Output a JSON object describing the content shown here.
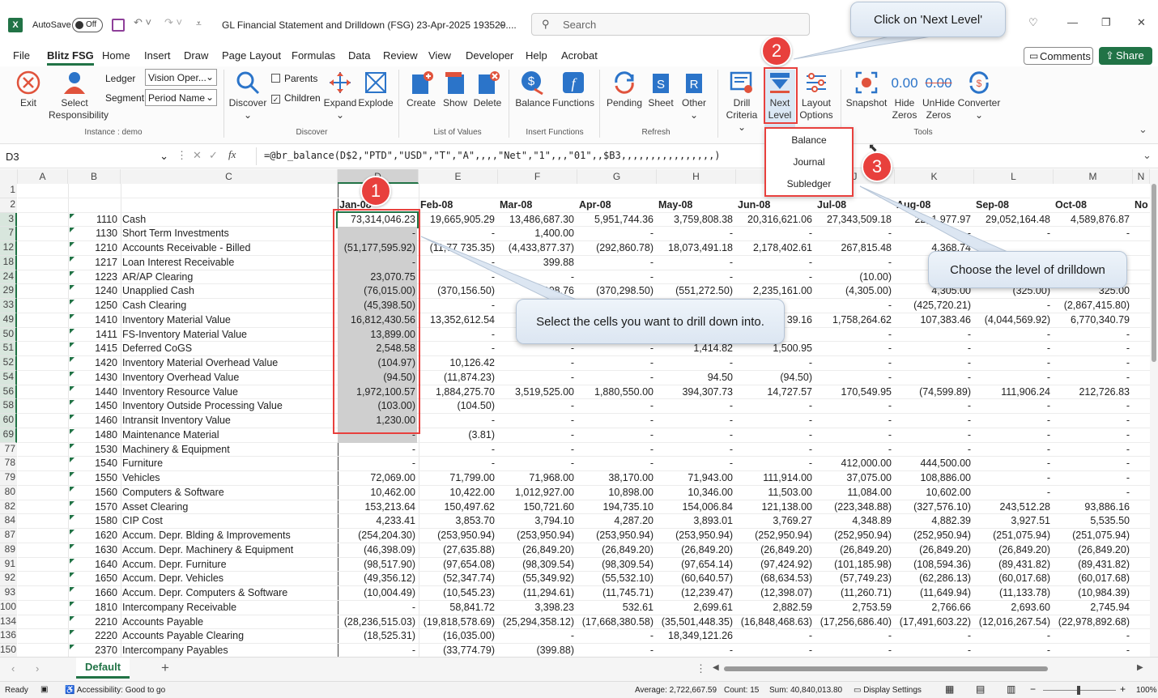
{
  "title": {
    "autosave": "AutoSave",
    "toggle": "Off",
    "doc": "GL Financial Statement and Drilldown (FSG) 23-Apr-2025 193529....",
    "search": "Search"
  },
  "menu": [
    "File",
    "Blitz FSG",
    "Home",
    "Insert",
    "Draw",
    "Page Layout",
    "Formulas",
    "Data",
    "Review",
    "View",
    "Developer",
    "Help",
    "Acrobat"
  ],
  "menu_right": {
    "comments": "Comments",
    "share": "Share"
  },
  "ribbon": {
    "exit": "Exit",
    "select_resp": "Select\nResponsibility",
    "ledger_label": "Ledger",
    "ledger_value": "Vision Oper...",
    "segment_label": "Segment",
    "segment_value": "Period Name",
    "instance": "Instance : demo",
    "discover": "Discover",
    "parents": "Parents",
    "children": "Children",
    "expand": "Expand",
    "explode": "Explode",
    "group_discover": "Discover",
    "create": "Create",
    "show": "Show",
    "delete": "Delete",
    "group_lov": "List of Values",
    "balance": "Balance",
    "functions": "Functions",
    "group_insert": "Insert Functions",
    "pending": "Pending",
    "sheet": "Sheet",
    "other": "Other",
    "group_refresh": "Refresh",
    "drill": "Drill",
    "criteria": "Criteria",
    "next": "Next",
    "level": "Level",
    "layout": "Layout",
    "options": "Options",
    "snapshot": "Snapshot",
    "hide": "Hide",
    "zeros": "Zeros",
    "unhide": "UnHide",
    "zeros2": "Zeros",
    "converter": "Converter",
    "group_tools": "Tools",
    "zero_text": "0.00"
  },
  "dropdown": [
    "Balance",
    "Journal",
    "Subledger"
  ],
  "formula": {
    "namebox": "D3",
    "fx": "fx",
    "text": "=@br_balance(D$2,\"PTD\",\"USD\",\"T\",\"A\",,,,\"Net\",\"1\",,,\"01\",,$B3,,,,,,,,,,,,,,,,)"
  },
  "columns": [
    "A",
    "B",
    "C",
    "D",
    "E",
    "F",
    "G",
    "H",
    "I",
    "J",
    "K",
    "L",
    "M",
    "N"
  ],
  "months": [
    "Jan-08",
    "Feb-08",
    "Mar-08",
    "Apr-08",
    "May-08",
    "Jun-08",
    "Jul-08",
    "Aug-08",
    "Sep-08",
    "Oct-08",
    "No"
  ],
  "rows": [
    {
      "r": "1",
      "code": "",
      "name": "",
      "v": [
        "",
        "",
        "",
        "",
        "",
        "",
        "",
        "",
        "",
        ""
      ]
    },
    {
      "r": "2",
      "code": "",
      "name": "",
      "v": [
        "",
        "",
        "",
        "",
        "",
        "",
        "",
        "",
        "",
        ""
      ]
    },
    {
      "r": "3",
      "code": "1110",
      "name": "Cash",
      "v": [
        "73,314,046.23",
        "19,665,905.29",
        "13,486,687.30",
        "5,951,744.36",
        "3,759,808.38",
        "20,316,621.06",
        "27,343,509.18",
        "22,  1,977.97",
        "29,052,164.48",
        "4,589,876.87"
      ]
    },
    {
      "r": "7",
      "code": "1130",
      "name": "Short Term Investments",
      "v": [
        "-",
        "-",
        "1,400.00",
        "-",
        "-",
        "-",
        "-",
        "-",
        "-",
        "-"
      ]
    },
    {
      "r": "12",
      "code": "1210",
      "name": "Accounts Receivable - Billed",
      "v": [
        "(51,177,595.92)",
        "(11,77  735.35)",
        "(4,433,877.37)",
        "(292,860.78)",
        "18,073,491.18",
        "2,178,402.61",
        "267,815.48",
        "4,368,74",
        "",
        ""
      ]
    },
    {
      "r": "18",
      "code": "1217",
      "name": "Loan Interest Receivable",
      "v": [
        "-",
        "-",
        "399.88",
        "-",
        "-",
        "-",
        "-",
        "",
        "",
        ""
      ]
    },
    {
      "r": "24",
      "code": "1223",
      "name": "AR/AP Clearing",
      "v": [
        "23,070.75",
        "-",
        "-",
        "-",
        "-",
        "-",
        "(10.00)",
        "",
        "",
        ""
      ]
    },
    {
      "r": "29",
      "code": "1240",
      "name": "Unapplied Cash",
      "v": [
        "(76,015.00)",
        "(370,156.50)",
        "(908,76",
        "(370,298.50)",
        "(551,272.50)",
        "2,235,161.00",
        "(4,305.00)",
        "4,305.00",
        "(325.00)",
        "325.00"
      ]
    },
    {
      "r": "33",
      "code": "1250",
      "name": "Cash Clearing",
      "v": [
        "(45,398.50)",
        "-",
        "",
        "",
        "",
        "",
        "-",
        "(425,720.21)",
        "-",
        "(2,867,415.80)"
      ]
    },
    {
      "r": "49",
      "code": "1410",
      "name": "Inventory Material Value",
      "v": [
        "16,812,430.56",
        "13,352,612.54",
        "16",
        "",
        "",
        "39.16",
        "1,758,264.62",
        "107,383.46",
        "(4,044,569.92)",
        "6,770,340.79"
      ]
    },
    {
      "r": "50",
      "code": "1411",
      "name": "FS-Inventory Material Value",
      "v": [
        "13,899.00",
        "-",
        "",
        "",
        "",
        "",
        "-",
        "-",
        "-",
        "-"
      ]
    },
    {
      "r": "51",
      "code": "1415",
      "name": "Deferred CoGS",
      "v": [
        "2,548.58",
        "-",
        "-",
        "-",
        "1,414.82",
        "1,500.95",
        "-",
        "-",
        "-",
        "-"
      ]
    },
    {
      "r": "52",
      "code": "1420",
      "name": "Inventory Material Overhead Value",
      "v": [
        "(104.97)",
        "10,126.42",
        "-",
        "-",
        "-",
        "-",
        "-",
        "-",
        "-",
        "-"
      ]
    },
    {
      "r": "54",
      "code": "1430",
      "name": "Inventory Overhead Value",
      "v": [
        "(94.50)",
        "(11,874.23)",
        "-",
        "-",
        "94.50",
        "(94.50)",
        "-",
        "-",
        "-",
        "-"
      ]
    },
    {
      "r": "56",
      "code": "1440",
      "name": "Inventory Resource Value",
      "v": [
        "1,972,100.57",
        "1,884,275.70",
        "3,519,525.00",
        "1,880,550.00",
        "394,307.73",
        "14,727.57",
        "170,549.95",
        "(74,599.89)",
        "111,906.24",
        "212,726.83"
      ]
    },
    {
      "r": "58",
      "code": "1450",
      "name": "Inventory Outside Processing Value",
      "v": [
        "(103.00)",
        "(104.50)",
        "-",
        "-",
        "-",
        "-",
        "-",
        "-",
        "-",
        "-"
      ]
    },
    {
      "r": "60",
      "code": "1460",
      "name": "Intransit Inventory Value",
      "v": [
        "1,230.00",
        "-",
        "-",
        "-",
        "-",
        "-",
        "-",
        "-",
        "-",
        "-"
      ]
    },
    {
      "r": "69",
      "code": "1480",
      "name": "Maintenance Material",
      "v": [
        "-",
        "(3.81)",
        "-",
        "-",
        "-",
        "-",
        "-",
        "-",
        "-",
        "-"
      ]
    },
    {
      "r": "77",
      "code": "1530",
      "name": "Machinery & Equipment",
      "v": [
        "-",
        "-",
        "-",
        "-",
        "-",
        "-",
        "-",
        "-",
        "-",
        "-"
      ]
    },
    {
      "r": "78",
      "code": "1540",
      "name": "Furniture",
      "v": [
        "-",
        "-",
        "-",
        "-",
        "-",
        "-",
        "412,000.00",
        "444,500.00",
        "-",
        "-"
      ]
    },
    {
      "r": "79",
      "code": "1550",
      "name": "Vehicles",
      "v": [
        "72,069.00",
        "71,799.00",
        "71,968.00",
        "38,170.00",
        "71,943.00",
        "111,914.00",
        "37,075.00",
        "108,886.00",
        "-",
        "-"
      ]
    },
    {
      "r": "80",
      "code": "1560",
      "name": "Computers & Software",
      "v": [
        "10,462.00",
        "10,422.00",
        "1,012,927.00",
        "10,898.00",
        "10,346.00",
        "11,503.00",
        "11,084.00",
        "10,602.00",
        "-",
        "-"
      ]
    },
    {
      "r": "82",
      "code": "1570",
      "name": "Asset Clearing",
      "v": [
        "153,213.64",
        "150,497.62",
        "150,721.60",
        "194,735.10",
        "154,006.84",
        "121,138.00",
        "(223,348.88)",
        "(327,576.10)",
        "243,512.28",
        "93,886.16"
      ]
    },
    {
      "r": "84",
      "code": "1580",
      "name": "CIP Cost",
      "v": [
        "4,233.41",
        "3,853.70",
        "3,794.10",
        "4,287.20",
        "3,893.01",
        "3,769.27",
        "4,348.89",
        "4,882.39",
        "3,927.51",
        "5,535.50"
      ]
    },
    {
      "r": "87",
      "code": "1620",
      "name": "Accum. Depr.  Blding & Improvements",
      "v": [
        "(254,204.30)",
        "(253,950.94)",
        "(253,950.94)",
        "(253,950.94)",
        "(253,950.94)",
        "(252,950.94)",
        "(252,950.94)",
        "(252,950.94)",
        "(251,075.94)",
        "(251,075.94)"
      ]
    },
    {
      "r": "89",
      "code": "1630",
      "name": "Accum. Depr.  Machinery & Equipment",
      "v": [
        "(46,398.09)",
        "(27,635.88)",
        "(26,849.20)",
        "(26,849.20)",
        "(26,849.20)",
        "(26,849.20)",
        "(26,849.20)",
        "(26,849.20)",
        "(26,849.20)",
        "(26,849.20)"
      ]
    },
    {
      "r": "91",
      "code": "1640",
      "name": "Accum. Depr.  Furniture",
      "v": [
        "(98,517.90)",
        "(97,654.08)",
        "(98,309.54)",
        "(98,309.54)",
        "(97,654.14)",
        "(97,424.92)",
        "(101,185.98)",
        "(108,594.36)",
        "(89,431.82)",
        "(89,431.82)"
      ]
    },
    {
      "r": "92",
      "code": "1650",
      "name": "Accum. Depr.  Vehicles",
      "v": [
        "(49,356.12)",
        "(52,347.74)",
        "(55,349.92)",
        "(55,532.10)",
        "(60,640.57)",
        "(68,634.53)",
        "(57,749.23)",
        "(62,286.13)",
        "(60,017.68)",
        "(60,017.68)"
      ]
    },
    {
      "r": "93",
      "code": "1660",
      "name": "Accum. Depr.  Computers & Software",
      "v": [
        "(10,004.49)",
        "(10,545.23)",
        "(11,294.61)",
        "(11,745.71)",
        "(12,239.47)",
        "(12,398.07)",
        "(11,260.71)",
        "(11,649.94)",
        "(11,133.78)",
        "(10,984.39)"
      ]
    },
    {
      "r": "100",
      "code": "1810",
      "name": "Intercompany Receivable",
      "v": [
        "-",
        "58,841.72",
        "3,398.23",
        "532.61",
        "2,699.61",
        "2,882.59",
        "2,753.59",
        "2,766.66",
        "2,693.60",
        "2,745.94"
      ]
    },
    {
      "r": "134",
      "code": "2210",
      "name": "Accounts Payable",
      "v": [
        "(28,236,515.03)",
        "(19,818,578.69)",
        "(25,294,358.12)",
        "(17,668,380.58)",
        "(35,501,448.35)",
        "(16,848,468.63)",
        "(17,256,686.40)",
        "(17,491,603.22)",
        "(12,016,267.54)",
        "(22,978,892.68)"
      ]
    },
    {
      "r": "136",
      "code": "2220",
      "name": "Accounts Payable Clearing",
      "v": [
        "(18,525.31)",
        "(16,035.00)",
        "-",
        "-",
        "18,349,121.26",
        "-",
        "-",
        "-",
        "-",
        "-"
      ]
    },
    {
      "r": "150",
      "code": "2370",
      "name": "Intercompany Payables",
      "v": [
        "-",
        "(33,774.79)",
        "(399.88)",
        "-",
        "-",
        "-",
        "-",
        "-",
        "-",
        "-"
      ]
    }
  ],
  "callouts": {
    "c1": "Select the cells you want to drill down into.",
    "c2": "Click on 'Next Level'",
    "c3": "Choose the level of drilldown"
  },
  "badges": [
    "1",
    "2",
    "3"
  ],
  "sheet_tab": "Default",
  "status": {
    "ready": "Ready",
    "access": "Accessibility: Good to go",
    "average": "Average: 2,722,667.59",
    "count": "Count: 15",
    "sum": "Sum: 40,840,013.80",
    "display": "Display Settings",
    "zoom": "100%"
  },
  "colors": {
    "accent": "#217346",
    "badge": "#e8403d",
    "blue": "#2b74c9"
  }
}
